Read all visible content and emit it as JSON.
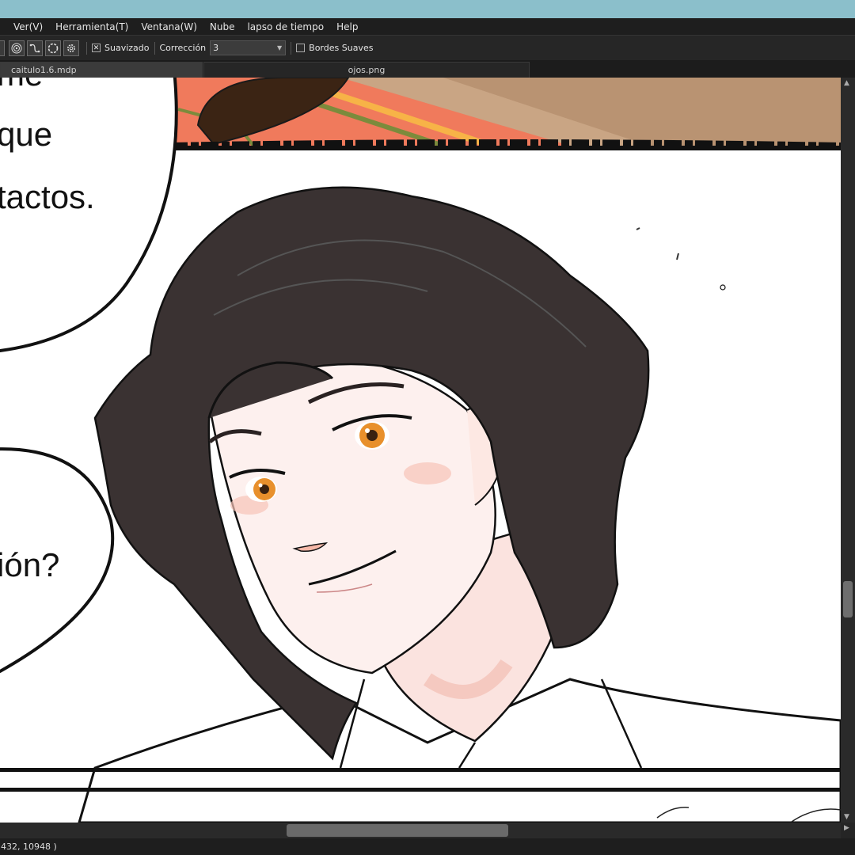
{
  "menu": {
    "items": [
      {
        "label": "Ver(V)"
      },
      {
        "label": "Herramienta(T)"
      },
      {
        "label": "Ventana(W)"
      },
      {
        "label": "Nube"
      },
      {
        "label": "lapso de tiempo"
      },
      {
        "label": "Help"
      }
    ]
  },
  "toolbar": {
    "smoothing_label": "Suavizado",
    "smoothing_checked": true,
    "correction_label": "Corrección",
    "correction_value": "3",
    "soft_edges_label": "Bordes Suaves",
    "soft_edges_checked": false,
    "icons": [
      "shape-icon",
      "ring-icon",
      "curve-icon",
      "circle-select-icon",
      "gear-icon"
    ]
  },
  "tabs": [
    {
      "label": "caitulo1.6.mdp",
      "active": true
    },
    {
      "label": "ojos.png",
      "active": false
    }
  ],
  "canvas": {
    "bubble_text": [
      "me",
      "que",
      "tactos.",
      "ión?"
    ]
  },
  "status": {
    "coordinates": "432, 10948 )"
  },
  "colors": {
    "app_bg": "#2b2b2b",
    "menubar_bg": "#1e1e1e",
    "top_strip": "#8bbfcb",
    "hair": "#3a3232",
    "iris": "#e8902c",
    "banner_orange": "#f07a5c"
  }
}
